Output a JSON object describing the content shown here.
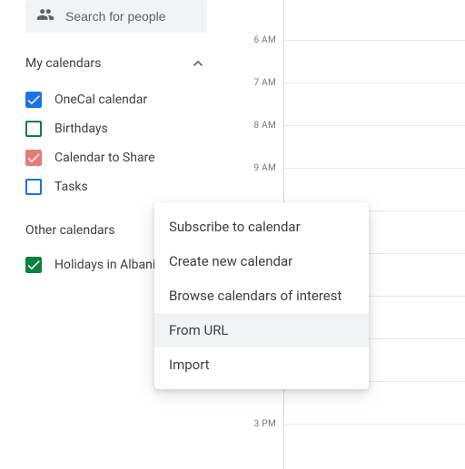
{
  "search": {
    "placeholder": "Search for people"
  },
  "sections": {
    "my": {
      "title": "My calendars"
    },
    "other": {
      "title": "Other calendars"
    }
  },
  "myCalendars": [
    {
      "label": "OneCal calendar",
      "checked": true,
      "color": "#1a73e8"
    },
    {
      "label": "Birthdays",
      "checked": false,
      "color": "#0b8043"
    },
    {
      "label": "Calendar to Share",
      "checked": true,
      "color": "#e67c73"
    },
    {
      "label": "Tasks",
      "checked": false,
      "color": "#1a73e8"
    }
  ],
  "otherCalendars": [
    {
      "label": "Holidays in Albani",
      "checked": true,
      "color": "#0b8043"
    }
  ],
  "popup": {
    "items": [
      {
        "label": "Subscribe to calendar",
        "hover": false
      },
      {
        "label": "Create new calendar",
        "hover": false
      },
      {
        "label": "Browse calendars of interest",
        "hover": false
      },
      {
        "label": "From URL",
        "hover": true
      },
      {
        "label": "Import",
        "hover": false
      }
    ]
  },
  "hours": [
    "6 AM",
    "7 AM",
    "8 AM",
    "9 AM",
    "",
    "",
    "",
    "",
    "",
    "3 PM"
  ],
  "icons": {
    "people": "people-icon",
    "chevronUp": "chevron-up-icon",
    "check": "check-icon"
  }
}
